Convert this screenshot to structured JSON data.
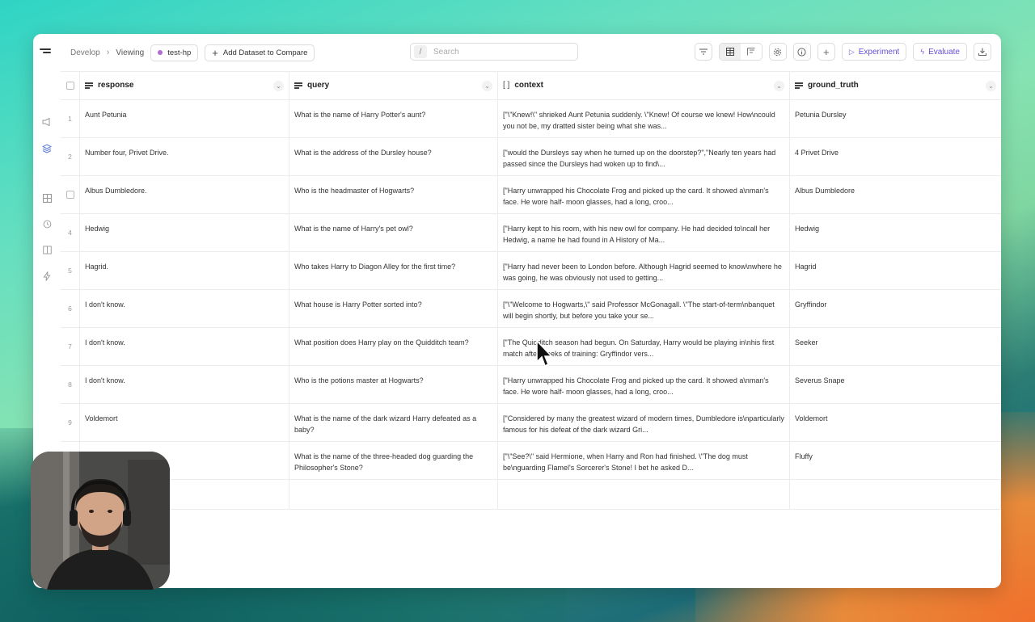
{
  "breadcrumb": {
    "develop": "Develop",
    "viewing": "Viewing",
    "dataset": "test-hp",
    "add_compare": "Add Dataset to Compare"
  },
  "search": {
    "shortcut": "/",
    "placeholder": "Search"
  },
  "toolbar": {
    "experiment": "Experiment",
    "evaluate": "Evaluate"
  },
  "columns": [
    {
      "name": "response",
      "icon": "text-lines-icon"
    },
    {
      "name": "query",
      "icon": "text-lines-icon"
    },
    {
      "name": "context",
      "icon": "array-brackets-icon"
    },
    {
      "name": "ground_truth",
      "icon": "text-lines-icon"
    }
  ],
  "rows": [
    {
      "index": "1",
      "response": "Aunt Petunia",
      "query": "What is the name of Harry Potter's aunt?",
      "context": "[\"\\\"Knew!\\\" shrieked Aunt Petunia suddenly. \\\"Knew! Of course we knew! How\\ncould you not be, my dratted sister being what she was...",
      "ground_truth": "Petunia Dursley"
    },
    {
      "index": "2",
      "response": "Number four, Privet Drive.",
      "query": "What is the address of the Dursley house?",
      "context": "[\"would the Dursleys say when he turned up on the doorstep?\",\"Nearly ten years had passed since the Dursleys had woken up to find\\...",
      "ground_truth": "4 Privet Drive"
    },
    {
      "index": "",
      "response": "Albus Dumbledore.",
      "query": "Who is the headmaster of Hogwarts?",
      "context": "[\"Harry unwrapped his Chocolate Frog and picked up the card. It showed a\\nman's face. He wore half- moon glasses, had a long, croo...",
      "ground_truth": "Albus Dumbledore"
    },
    {
      "index": "4",
      "response": "Hedwig",
      "query": "What is the name of Harry's pet owl?",
      "context": "[\"Harry kept to his room, with his new owl for company. He had decided to\\ncall her Hedwig, a name he had found in A History of Ma...",
      "ground_truth": "Hedwig"
    },
    {
      "index": "5",
      "response": "Hagrid.",
      "query": "Who takes Harry to Diagon Alley for the first time?",
      "context": "[\"Harry had never been to London before. Although Hagrid seemed to know\\nwhere he was going, he was obviously not used to getting...",
      "ground_truth": "Hagrid"
    },
    {
      "index": "6",
      "response": "I don't know.",
      "query": "What house is Harry Potter sorted into?",
      "context": "[\"\\\"Welcome to Hogwarts,\\\" said Professor McGonagall. \\\"The start-of-term\\nbanquet will begin shortly, but before you take your se...",
      "ground_truth": "Gryffindor"
    },
    {
      "index": "7",
      "response": "I don't know.",
      "query": "What position does Harry play on the Quidditch team?",
      "context": "[\"The Quidditch season had begun. On Saturday, Harry would be playing in\\nhis first match after weeks of training: Gryffindor vers...",
      "ground_truth": "Seeker"
    },
    {
      "index": "8",
      "response": "I don't know.",
      "query": "Who is the potions master at Hogwarts?",
      "context": "[\"Harry unwrapped his Chocolate Frog and picked up the card. It showed a\\nman's face. He wore half- moon glasses, had a long, croo...",
      "ground_truth": "Severus Snape"
    },
    {
      "index": "9",
      "response": "Voldemort",
      "query": "What is the name of the dark wizard Harry defeated as a baby?",
      "context": "[\"Considered by many the greatest wizard of modern times, Dumbledore is\\nparticularly famous for his defeat of the dark wizard Gri...",
      "ground_truth": "Voldemort"
    },
    {
      "index": "",
      "response": "",
      "query": "What is the name of the three-headed dog guarding the Philosopher's Stone?",
      "context": "[\"\\\"See?\\\" said Hermione, when Harry and Ron had finished. \\\"The dog must be\\nguarding Flamel's Sorcerer's Stone! I bet he asked D...",
      "ground_truth": "Fluffy"
    }
  ],
  "colors": {
    "accent": "#6a4fd6",
    "dataset_dot": "#b06ad6"
  }
}
